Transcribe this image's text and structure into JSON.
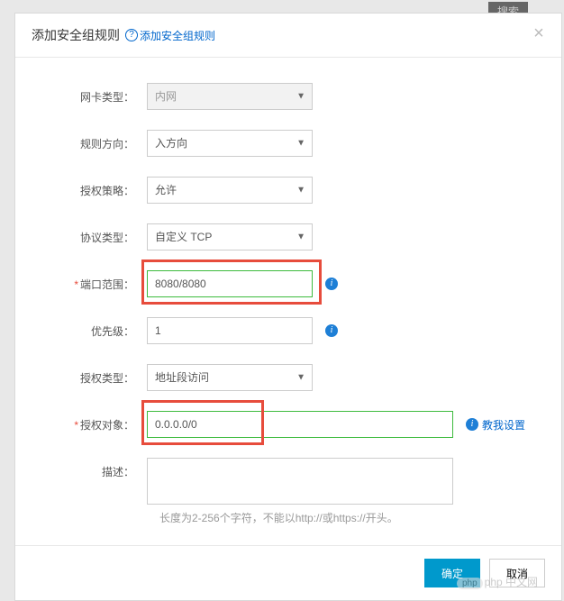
{
  "bg": {
    "search": "搜索"
  },
  "modal": {
    "title": "添加安全组规则",
    "help_label": "添加安全组规则",
    "close": "×"
  },
  "form": {
    "nic_type": {
      "label": "网卡类型：",
      "value": "内网"
    },
    "direction": {
      "label": "规则方向：",
      "value": "入方向"
    },
    "policy": {
      "label": "授权策略：",
      "value": "允许"
    },
    "protocol": {
      "label": "协议类型：",
      "value": "自定义 TCP"
    },
    "port": {
      "label": "端口范围：",
      "value": "8080/8080"
    },
    "priority": {
      "label": "优先级：",
      "value": "1"
    },
    "auth_type": {
      "label": "授权类型：",
      "value": "地址段访问"
    },
    "auth_obj": {
      "label": "授权对象：",
      "value": "0.0.0.0/0",
      "teach": "教我设置"
    },
    "desc": {
      "label": "描述：",
      "value": "",
      "hint": "长度为2-256个字符，不能以http://或https://开头。"
    }
  },
  "footer": {
    "ok": "确定",
    "cancel": "取消"
  },
  "watermark": "php 中文网"
}
